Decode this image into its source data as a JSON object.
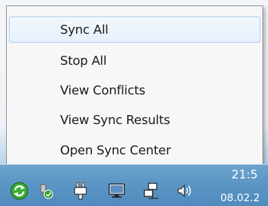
{
  "menu": {
    "items": [
      {
        "label": "Sync All",
        "highlighted": true
      },
      {
        "label": "Stop All",
        "highlighted": false
      },
      {
        "label": "View Conflicts",
        "highlighted": false
      },
      {
        "label": "View Sync Results",
        "highlighted": false
      },
      {
        "label": "Open Sync Center",
        "highlighted": false
      }
    ]
  },
  "taskbar": {
    "tray_icons": [
      "sync-center-icon",
      "network-shield-icon",
      "power-plug-icon",
      "monitor-icon",
      "network-icon",
      "volume-icon"
    ],
    "clock": {
      "time": "21:5",
      "date": "08.02.2"
    }
  },
  "colors": {
    "menu_highlight": "#e6f0fb",
    "menu_highlight_border": "#a9cbed",
    "taskbar": "#5c97c6"
  }
}
